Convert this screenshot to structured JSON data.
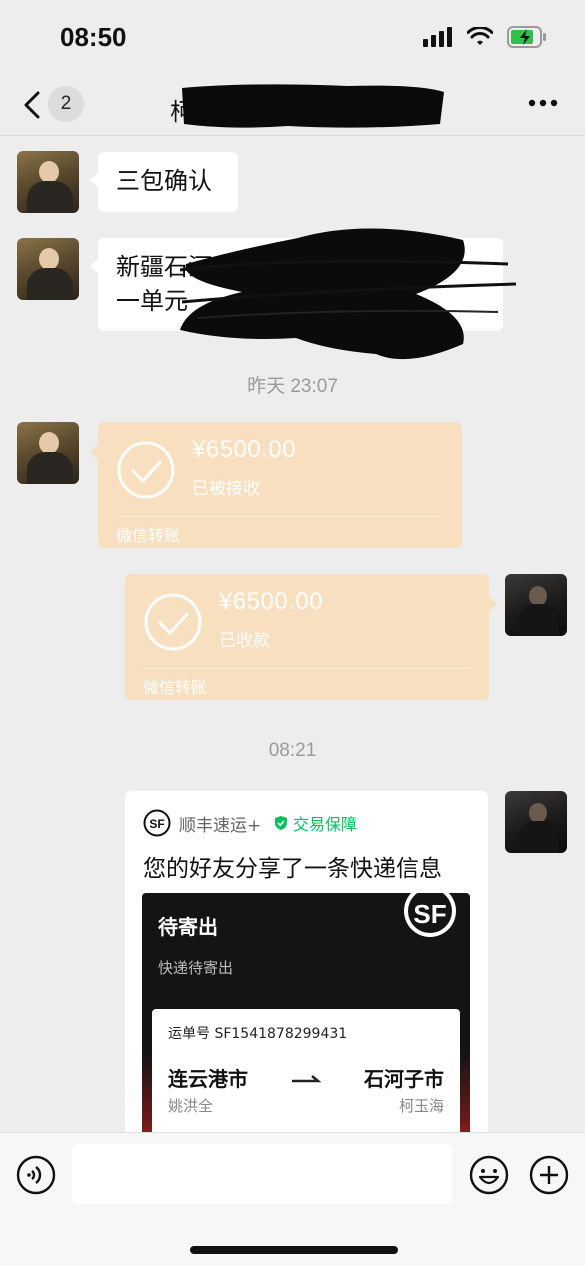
{
  "status_bar": {
    "time": "08:50"
  },
  "nav": {
    "unread_count": "2",
    "title_visible_char": "柯"
  },
  "messages": {
    "msg1_text": "三包确认",
    "msg2_line1": "新疆石河子市",
    "msg2_line2": "一单元",
    "timestamp1": "昨天 23:07",
    "transfer1": {
      "amount": "¥6500.00",
      "status": "已被接收",
      "label": "微信转账"
    },
    "transfer2": {
      "amount": "¥6500.00",
      "status": "已收款",
      "label": "微信转账"
    },
    "timestamp2": "08:21"
  },
  "share_card": {
    "source": "顺丰速运+",
    "guarantee": "交易保障",
    "title": "您的好友分享了一条快递信息",
    "express": {
      "status": "待寄出",
      "sub_status": "快递待寄出",
      "waybill_label": "运单号",
      "waybill_number": "SF1541878299431",
      "from_city": "连云港市",
      "from_name": "姚洪全",
      "to_city": "石河子市",
      "to_name": "柯玉海"
    }
  },
  "input": {
    "placeholder": ""
  },
  "colors": {
    "background": "#ededed",
    "transfer_bubble": "#f7dfbf",
    "guarantee_green": "#07c160",
    "express_dark": "#141414",
    "express_red": "#b02323"
  },
  "icons": [
    "signal-icon",
    "wifi-icon",
    "battery-icon",
    "back-icon",
    "more-icon",
    "check-circle-icon",
    "sf-logo-icon",
    "shield-icon",
    "route-arrow-icon",
    "voice-icon",
    "emoji-icon",
    "plus-icon"
  ]
}
